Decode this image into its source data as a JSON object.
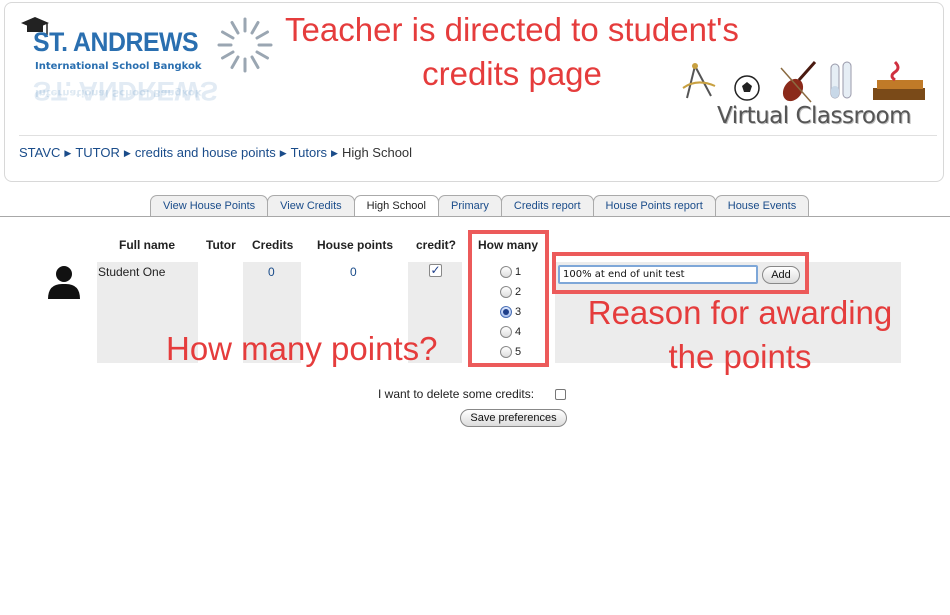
{
  "header": {
    "logo_main": "ST. ANDREWS",
    "logo_sub": "International School Bangkok",
    "brand": "Virtual Classroom"
  },
  "breadcrumb": {
    "items": [
      "STAVC",
      "TUTOR",
      "credits and house points",
      "Tutors"
    ],
    "current": "High School"
  },
  "tabs": [
    {
      "label": "View House Points",
      "active": false
    },
    {
      "label": "View Credits",
      "active": false
    },
    {
      "label": "High School",
      "active": true
    },
    {
      "label": "Primary",
      "active": false
    },
    {
      "label": "Credits report",
      "active": false
    },
    {
      "label": "House Points report",
      "active": false
    },
    {
      "label": "House Events",
      "active": false
    }
  ],
  "table": {
    "headers": {
      "full_name": "Full name",
      "tutor": "Tutor",
      "credits": "Credits",
      "house_points": "House points",
      "credit": "credit?",
      "how_many": "How many"
    },
    "row": {
      "full_name": "Student One",
      "tutor": "",
      "credits": "0",
      "house_points": "0",
      "credit_checked": true,
      "how_many_options": [
        "1",
        "2",
        "3",
        "4",
        "5"
      ],
      "how_many_selected": "3",
      "reason_value": "100% at end of unit test",
      "add_label": "Add"
    }
  },
  "footer": {
    "delete_label": "I want to delete some credits:",
    "delete_checked": false,
    "save_label": "Save preferences"
  },
  "annotations": {
    "title_line1": "Teacher is directed to student's",
    "title_line2": "credits page",
    "how_many": "How many points?",
    "reason_line1": "Reason for awarding",
    "reason_line2": "the points"
  },
  "colors": {
    "annotation": "#e53c3c",
    "link": "#1a4c8a",
    "logo": "#2a6fb0"
  }
}
